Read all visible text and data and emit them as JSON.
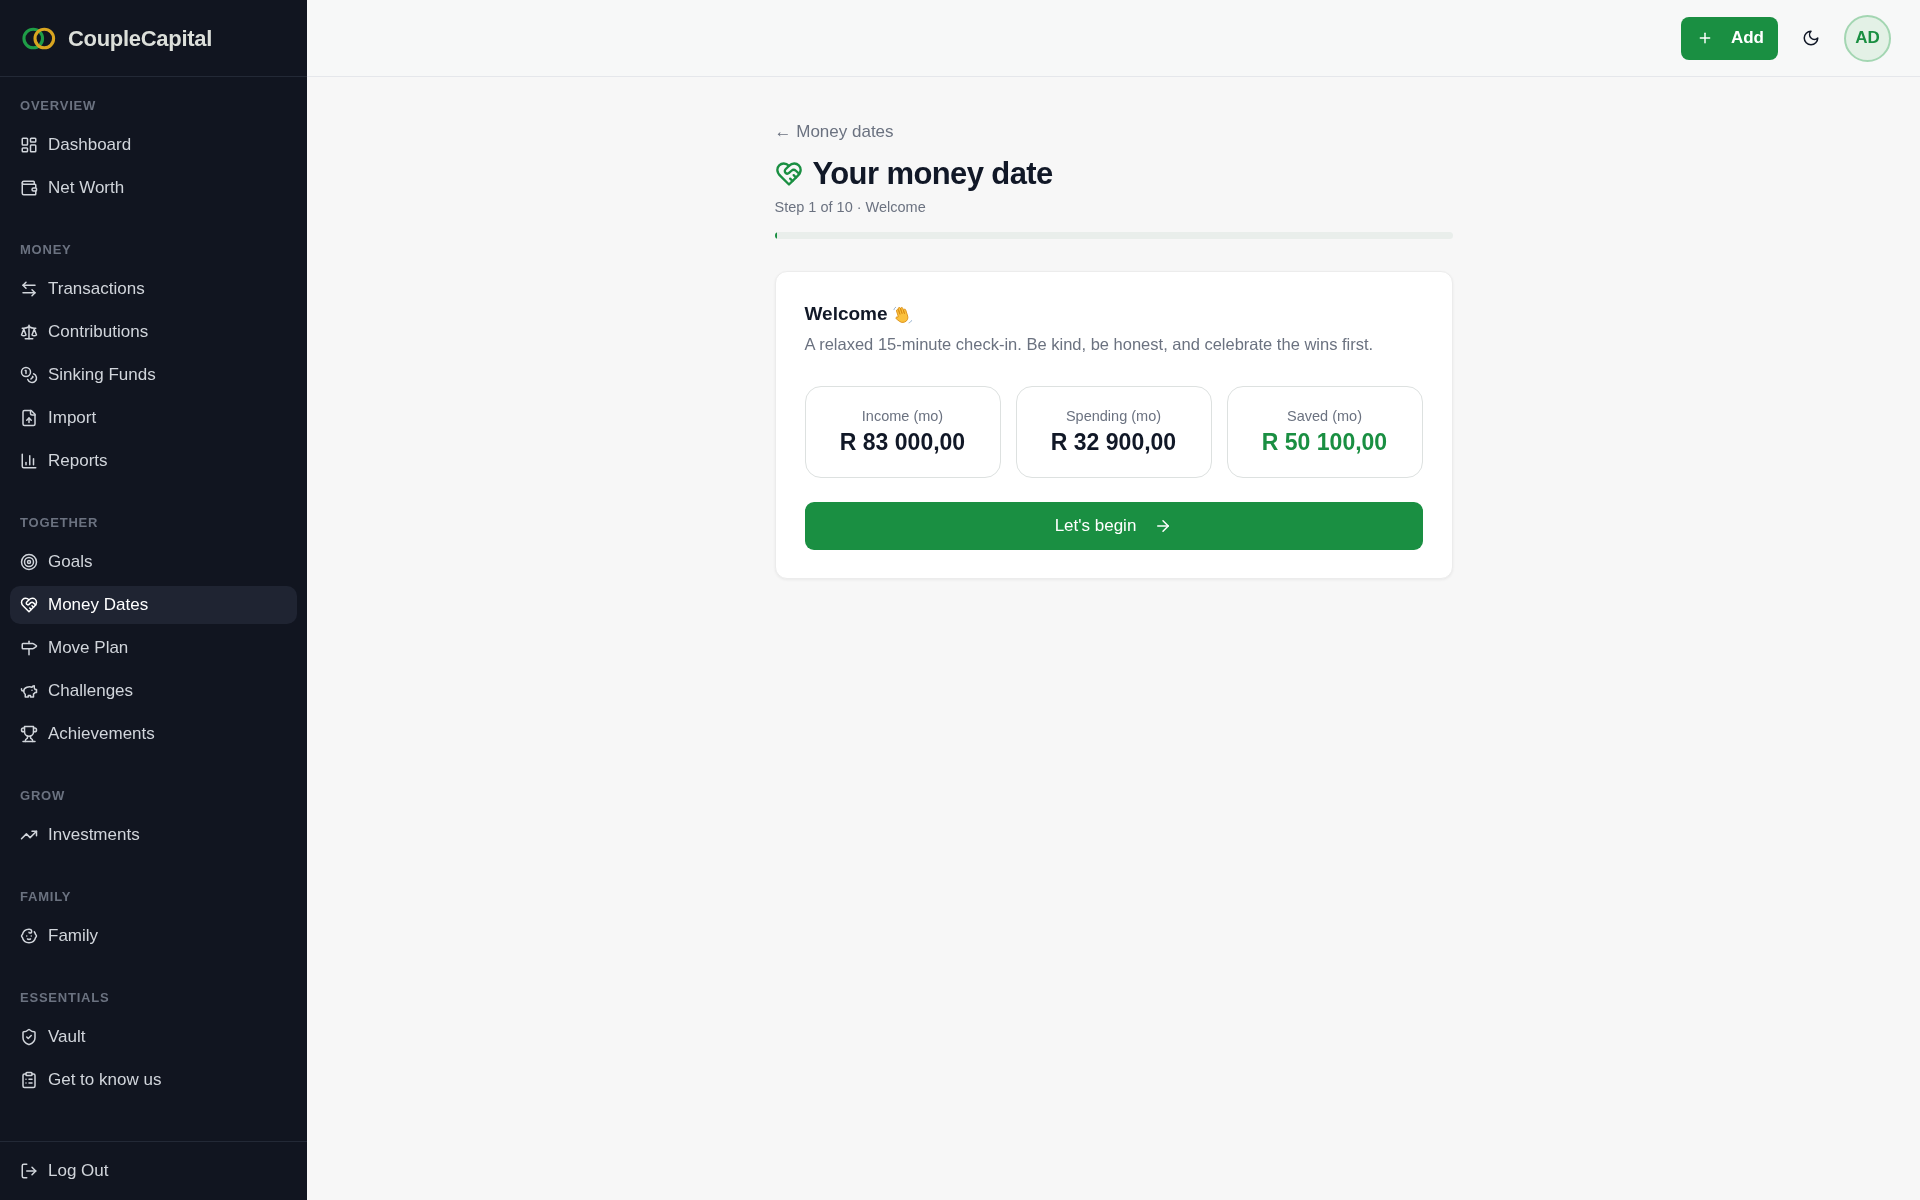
{
  "brand": {
    "name": "CoupleCapital"
  },
  "sidebar": {
    "sections": [
      {
        "label": "OVERVIEW",
        "items": [
          {
            "label": "Dashboard",
            "selected": false
          },
          {
            "label": "Net Worth",
            "selected": false
          }
        ]
      },
      {
        "label": "MONEY",
        "items": [
          {
            "label": "Transactions",
            "selected": false
          },
          {
            "label": "Contributions",
            "selected": false
          },
          {
            "label": "Sinking Funds",
            "selected": false
          },
          {
            "label": "Import",
            "selected": false
          },
          {
            "label": "Reports",
            "selected": false
          }
        ]
      },
      {
        "label": "TOGETHER",
        "items": [
          {
            "label": "Goals",
            "selected": false
          },
          {
            "label": "Money Dates",
            "selected": true
          },
          {
            "label": "Move Plan",
            "selected": false
          },
          {
            "label": "Challenges",
            "selected": false
          },
          {
            "label": "Achievements",
            "selected": false
          }
        ]
      },
      {
        "label": "GROW",
        "items": [
          {
            "label": "Investments",
            "selected": false
          }
        ]
      },
      {
        "label": "FAMILY",
        "items": [
          {
            "label": "Family",
            "selected": false
          }
        ]
      },
      {
        "label": "ESSENTIALS",
        "items": [
          {
            "label": "Vault",
            "selected": false
          },
          {
            "label": "Get to know us",
            "selected": false
          }
        ]
      }
    ],
    "footer_item": {
      "label": "Log Out"
    }
  },
  "top_bar": {
    "add_button": {
      "label": "Add"
    },
    "avatar": {
      "initials": "AD"
    }
  },
  "page": {
    "back_link": "← Money dates",
    "title": "Your money date",
    "subtitle": "Step 1 of 10 · Welcome",
    "progress": {
      "level": 0.004
    }
  },
  "card": {
    "title": "Welcome",
    "description": "A relaxed 15-minute check-in. Be kind, be honest, and celebrate the wins first.",
    "stats": [
      {
        "label": "Income (mo)",
        "value": "R 83 000,00",
        "color": "#111827"
      },
      {
        "label": "Spending (mo)",
        "value": "R 32 900,00",
        "color": "#111827"
      },
      {
        "label": "Saved (mo)",
        "value": "R 50 100,00",
        "color": "#1a8f42"
      }
    ],
    "button": {
      "label": "Let's begin"
    }
  }
}
